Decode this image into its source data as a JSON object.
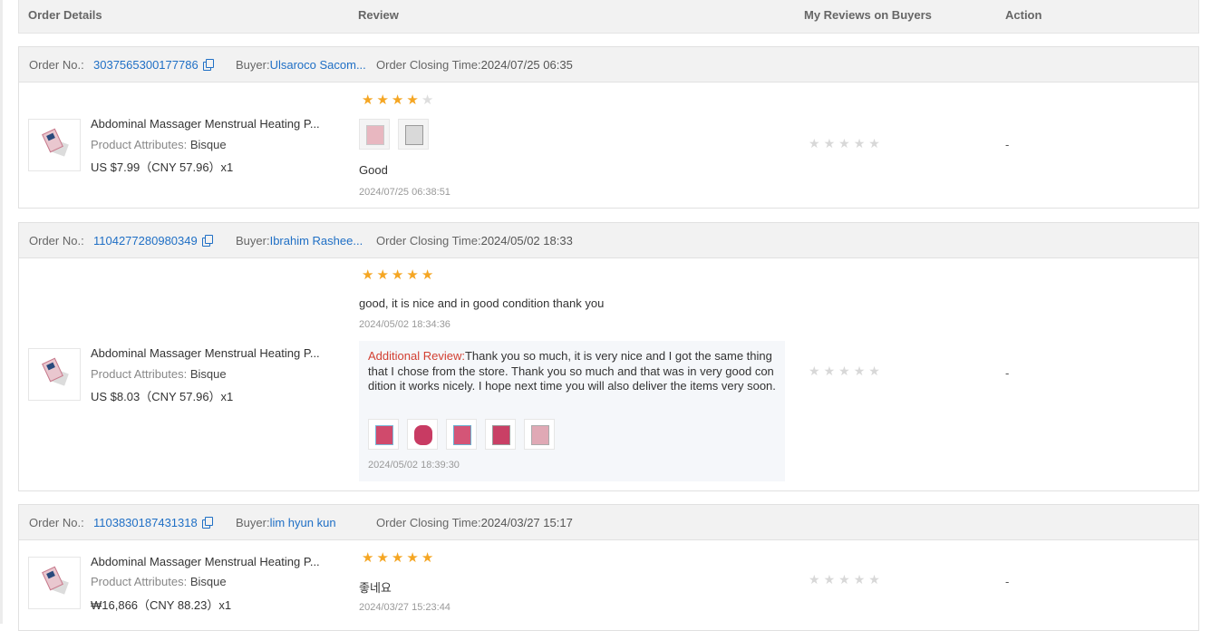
{
  "columns": {
    "order_details": "Order Details",
    "review": "Review",
    "my_reviews": "My Reviews on Buyers",
    "action": "Action"
  },
  "labels": {
    "order_no": "Order No.:",
    "buyer": "Buyer:",
    "closing": "Order Closing Time:",
    "attr": "Product Attributes:",
    "additional": "Additional Review:"
  },
  "orders": [
    {
      "order_no": "3037565300177786",
      "buyer": "Ulsaroco Sacom...",
      "closing_time": "2024/07/25 06:35",
      "product_name": "Abdominal Massager Menstrual Heating P...",
      "attribute": "Bisque",
      "price": "US $7.99（CNY  57.96）x1",
      "rating": 4,
      "review_text": "Good",
      "review_time": "2024/07/25 06:38:51",
      "review_image_count": 2,
      "action": "-"
    },
    {
      "order_no": "1104277280980349",
      "buyer": "Ibrahim Rashee...",
      "closing_time": "2024/05/02 18:33",
      "product_name": "Abdominal Massager Menstrual Heating P...",
      "attribute": "Bisque",
      "price": "US $8.03（CNY  57.96）x1",
      "rating": 5,
      "review_text": "good, it is nice and in good condition thank you",
      "review_time": "2024/05/02 18:34:36",
      "additional_text": "Thank you so much, it is very nice and I got the same thing that I chose from the store. Thank you so much and that was in very good condition it works nicely. I hope next time you will also deliver the items very soon.",
      "additional_time": "2024/05/02 18:39:30",
      "additional_image_count": 5,
      "action": "-"
    },
    {
      "order_no": "1103830187431318",
      "buyer": "lim hyun kun",
      "closing_time": "2024/03/27 15:17",
      "product_name": "Abdominal Massager Menstrual Heating P...",
      "attribute": "Bisque",
      "price": "₩16,866（CNY  88.23）x1",
      "rating": 5,
      "review_text": "좋네요",
      "review_time": "2024/03/27 15:23:44",
      "action": "-"
    }
  ],
  "colors": {
    "link": "#1f6fc5",
    "star_on": "#f5a623",
    "additional_label": "#d23f31"
  }
}
